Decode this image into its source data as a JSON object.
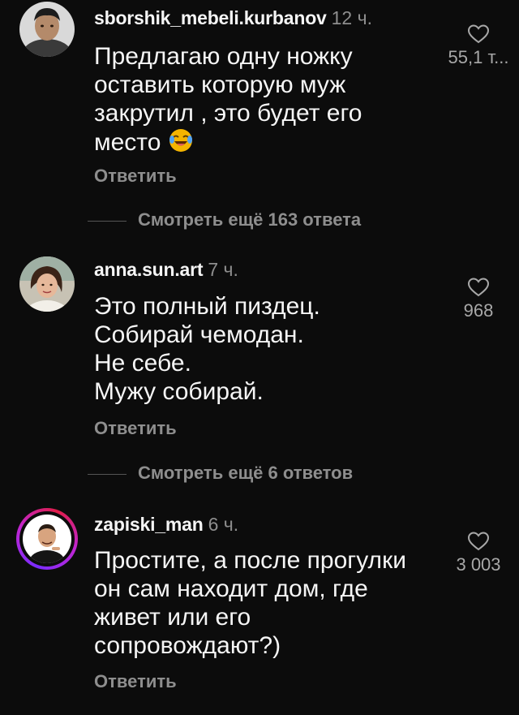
{
  "comments": [
    {
      "username": "sborshik_mebeli.kurbanov",
      "time": "12 ч.",
      "text": "Предлагаю одну ножку оставить которую муж закрутил , это будет его место",
      "emoji": "😂",
      "likes": "55,1 т...",
      "reply_label": "Ответить",
      "more_replies": "Смотреть ещё 163 ответа"
    },
    {
      "username": "anna.sun.art",
      "time": "7 ч.",
      "lines": [
        "Это полный пиздец.",
        "Собирай чемодан.",
        "Не себе.",
        "Мужу собирай."
      ],
      "likes": "968",
      "reply_label": "Ответить",
      "more_replies": "Смотреть ещё 6 ответов"
    },
    {
      "username": "zapiski_man",
      "time": "6 ч.",
      "text": "Простите, а после прогулки он сам находит дом, где живет или его сопровождают?)",
      "likes": "3 003",
      "reply_label": "Ответить"
    }
  ],
  "icons": {
    "like": "heart-outline-icon"
  },
  "colors": {
    "background": "#0c0c0c",
    "primary_text": "#f5f5f5",
    "secondary_text": "#8e8e8e",
    "story_ring": [
      "#7a2cff",
      "#c026d3",
      "#e11d48"
    ]
  }
}
